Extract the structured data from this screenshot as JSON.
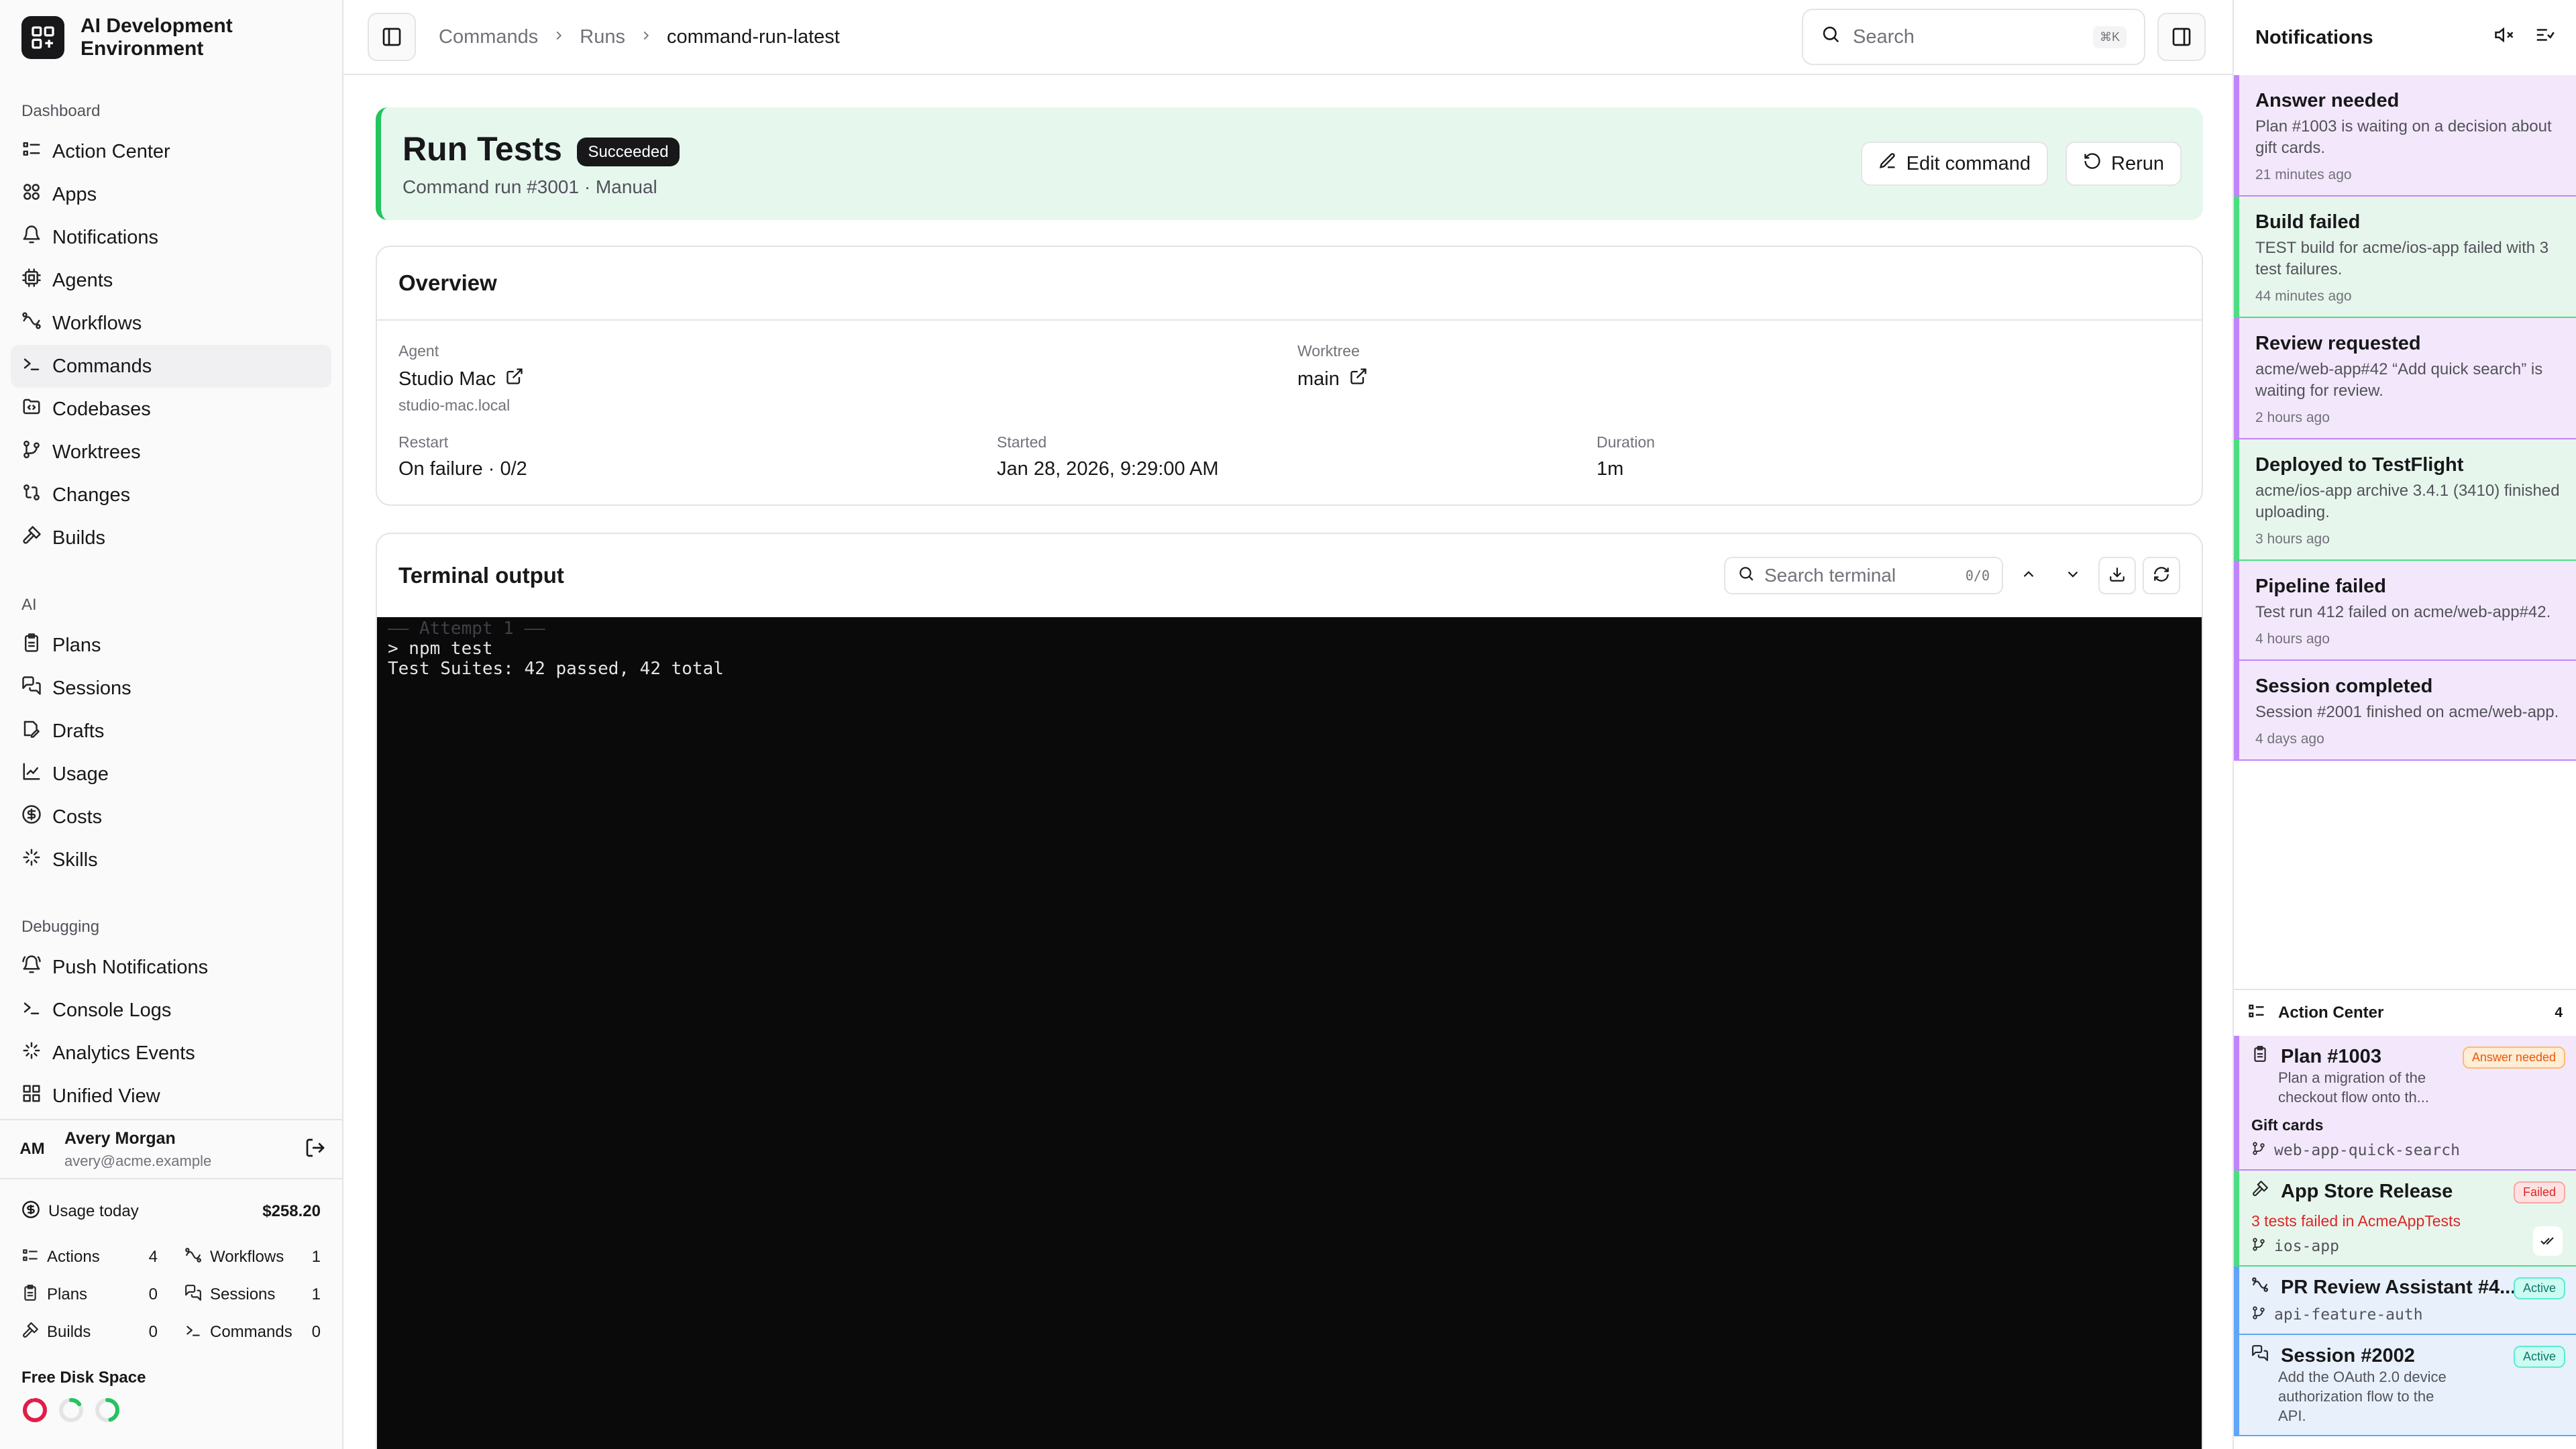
{
  "app": {
    "title": "AI Development Environment"
  },
  "sidebar": {
    "sections": [
      {
        "label": "Dashboard",
        "items": [
          {
            "label": "Action Center",
            "icon": "list-check-icon"
          },
          {
            "label": "Apps",
            "icon": "apps-icon"
          },
          {
            "label": "Notifications",
            "icon": "bell-icon"
          },
          {
            "label": "Agents",
            "icon": "cpu-icon"
          },
          {
            "label": "Workflows",
            "icon": "workflow-icon"
          },
          {
            "label": "Commands",
            "icon": "terminal-icon",
            "active": true
          },
          {
            "label": "Codebases",
            "icon": "folder-code-icon"
          },
          {
            "label": "Worktrees",
            "icon": "git-branch-icon"
          },
          {
            "label": "Changes",
            "icon": "git-compare-icon"
          },
          {
            "label": "Builds",
            "icon": "hammer-icon"
          }
        ]
      },
      {
        "label": "AI",
        "items": [
          {
            "label": "Plans",
            "icon": "clipboard-icon"
          },
          {
            "label": "Sessions",
            "icon": "chat-icon"
          },
          {
            "label": "Drafts",
            "icon": "draft-icon"
          },
          {
            "label": "Usage",
            "icon": "chart-icon"
          },
          {
            "label": "Costs",
            "icon": "dollar-icon"
          },
          {
            "label": "Skills",
            "icon": "sparkle-icon"
          }
        ]
      },
      {
        "label": "Debugging",
        "items": [
          {
            "label": "Push Notifications",
            "icon": "bell-ring-icon"
          },
          {
            "label": "Console Logs",
            "icon": "terminal-icon"
          },
          {
            "label": "Analytics Events",
            "icon": "sparkle-icon"
          },
          {
            "label": "Unified View",
            "icon": "grid-icon"
          }
        ]
      }
    ],
    "user": {
      "initials": "AM",
      "name": "Avery Morgan",
      "email": "avery@acme.example"
    },
    "usage": {
      "label": "Usage today",
      "value": "$258.20",
      "stats": [
        {
          "label": "Actions",
          "value": "4"
        },
        {
          "label": "Workflows",
          "value": "1"
        },
        {
          "label": "Plans",
          "value": "0"
        },
        {
          "label": "Sessions",
          "value": "1"
        },
        {
          "label": "Builds",
          "value": "0"
        },
        {
          "label": "Commands",
          "value": "0"
        }
      ]
    },
    "disk": {
      "label": "Free Disk Space",
      "rings": [
        {
          "color": "#e11d48",
          "fraction": 0.05
        },
        {
          "color": "#22c55e",
          "fraction": 0.85
        },
        {
          "color": "#22c55e",
          "fraction": 0.55
        }
      ]
    }
  },
  "topbar": {
    "breadcrumbs": [
      "Commands",
      "Runs",
      "command-run-latest"
    ],
    "search_placeholder": "Search",
    "search_shortcut": "⌘K"
  },
  "run": {
    "title": "Run Tests",
    "status": "Succeeded",
    "subtitle": "Command run #3001 · Manual",
    "edit_label": "Edit command",
    "rerun_label": "Rerun"
  },
  "overview": {
    "title": "Overview",
    "agent_label": "Agent",
    "agent": "Studio Mac",
    "agent_host": "studio-mac.local",
    "worktree_label": "Worktree",
    "worktree": "main",
    "restart_label": "Restart",
    "restart": "On failure · 0/2",
    "started_label": "Started",
    "started": "Jan 28, 2026, 9:29:00 AM",
    "duration_label": "Duration",
    "duration": "1m"
  },
  "terminal": {
    "title": "Terminal output",
    "search_placeholder": "Search terminal",
    "match_count": "0/0",
    "lines": [
      {
        "text": "—— Attempt 1 ——",
        "dim": true
      },
      {
        "text": "> npm test",
        "dim": false
      },
      {
        "text": "Test Suites: 42 passed, 42 total",
        "dim": false
      }
    ]
  },
  "notifications": {
    "title": "Notifications",
    "items": [
      {
        "title": "Answer needed",
        "body": "Plan #1003 is waiting on a decision about gift cards.",
        "time": "21 minutes ago",
        "tone": "p"
      },
      {
        "title": "Build failed",
        "body": "TEST build for acme/ios-app failed with 3 test failures.",
        "time": "44 minutes ago",
        "tone": "g"
      },
      {
        "title": "Review requested",
        "body": "acme/web-app#42 “Add quick search” is waiting for review.",
        "time": "2 hours ago",
        "tone": "p"
      },
      {
        "title": "Deployed to TestFlight",
        "body": "acme/ios-app archive 3.4.1 (3410) finished uploading.",
        "time": "3 hours ago",
        "tone": "g"
      },
      {
        "title": "Pipeline failed",
        "body": "Test run 412 failed on acme/web-app#42.",
        "time": "4 hours ago",
        "tone": "p"
      },
      {
        "title": "Session completed",
        "body": "Session #2001 finished on acme/web-app.",
        "time": "4 days ago",
        "tone": "p"
      }
    ]
  },
  "action_center": {
    "title": "Action Center",
    "count": "4",
    "items": [
      {
        "title": "Plan #1003",
        "badge": "Answer needed",
        "badge_tone": "o",
        "body": "Plan a migration of the checkout flow onto th...",
        "extra": "Gift cards",
        "branch": "web-app-quick-search",
        "tone": "p",
        "icon": "clipboard-icon"
      },
      {
        "title": "App Store Release",
        "badge": "Failed",
        "badge_tone": "r",
        "error": "3 tests failed in AcmeAppTests",
        "branch": "ios-app",
        "tone": "g",
        "icon": "hammer-icon"
      },
      {
        "title": "PR Review Assistant #4...",
        "badge": "Active",
        "badge_tone": "a",
        "branch": "api-feature-auth",
        "tone": "b",
        "icon": "workflow-icon"
      },
      {
        "title": "Session #2002",
        "badge": "Active",
        "badge_tone": "a",
        "body": "Add the OAuth 2.0 device authorization flow to the API.",
        "tone": "b",
        "icon": "chat-icon"
      }
    ]
  },
  "colors": {
    "accent_success": "#22c55e",
    "tone_purple": "#c084fc",
    "tone_blue": "#60a5fa",
    "danger": "#dc2626"
  }
}
